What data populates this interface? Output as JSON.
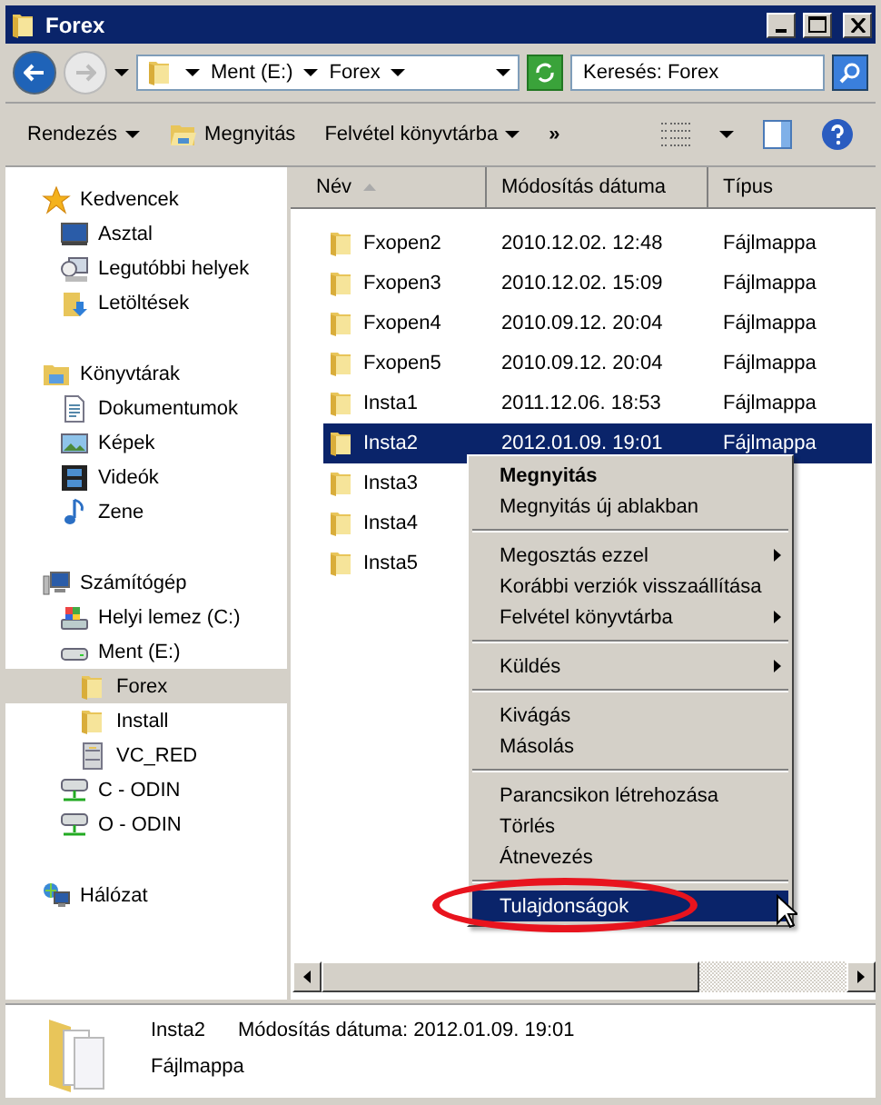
{
  "window": {
    "title": "Forex"
  },
  "address": {
    "crumbs": [
      "Ment (E:)",
      "Forex"
    ],
    "search_placeholder": "Keresés: Forex"
  },
  "toolbar": {
    "items": [
      {
        "label": "Rendezés",
        "kind": "dropdown"
      },
      {
        "label": "Megnyitás",
        "kind": "open"
      },
      {
        "label": "Felvétel könyvtárba",
        "kind": "dropdown"
      },
      {
        "label": "»",
        "kind": "more"
      }
    ]
  },
  "sidebar": {
    "groups": [
      {
        "label": "Kedvencek",
        "kind": "star",
        "children": [
          {
            "label": "Asztal",
            "kind": "desktop",
            "selected": false
          },
          {
            "label": "Legutóbbi helyek",
            "kind": "recent",
            "selected": false
          },
          {
            "label": "Letöltések",
            "kind": "downloads",
            "selected": false
          }
        ]
      },
      {
        "label": "Könyvtárak",
        "kind": "library",
        "children": [
          {
            "label": "Dokumentumok",
            "kind": "document",
            "selected": false
          },
          {
            "label": "Képek",
            "kind": "pictures",
            "selected": false
          },
          {
            "label": "Videók",
            "kind": "video",
            "selected": false
          },
          {
            "label": "Zene",
            "kind": "music",
            "selected": false
          }
        ]
      },
      {
        "label": "Számítógép",
        "kind": "computer",
        "children": [
          {
            "label": "Helyi lemez (C:)",
            "kind": "disk",
            "selected": false
          },
          {
            "label": "Ment (E:)",
            "kind": "drive",
            "selected": false,
            "children": [
              {
                "label": "Forex",
                "kind": "folder",
                "selected": true
              },
              {
                "label": "Install",
                "kind": "folder",
                "selected": false
              },
              {
                "label": "VC_RED",
                "kind": "cabinet",
                "selected": false
              }
            ]
          },
          {
            "label": "C - ODIN",
            "kind": "netdrive",
            "selected": false
          },
          {
            "label": "O - ODIN",
            "kind": "netdrive",
            "selected": false
          }
        ]
      },
      {
        "label": "Hálózat",
        "kind": "network"
      }
    ]
  },
  "table": {
    "columns": [
      {
        "label": "Név",
        "sorted": true
      },
      {
        "label": "Módosítás dátuma",
        "sorted": false
      },
      {
        "label": "Típus",
        "sorted": false
      }
    ],
    "rows": [
      {
        "name": "Fxopen2",
        "date": "2010.12.02. 12:48",
        "type": "Fájlmappa",
        "selected": false
      },
      {
        "name": "Fxopen3",
        "date": "2010.12.02. 15:09",
        "type": "Fájlmappa",
        "selected": false
      },
      {
        "name": "Fxopen4",
        "date": "2010.09.12. 20:04",
        "type": "Fájlmappa",
        "selected": false
      },
      {
        "name": "Fxopen5",
        "date": "2010.09.12. 20:04",
        "type": "Fájlmappa",
        "selected": false
      },
      {
        "name": "Insta1",
        "date": "2011.12.06. 18:53",
        "type": "Fájlmappa",
        "selected": false
      },
      {
        "name": "Insta2",
        "date": "2012.01.09. 19:01",
        "type": "Fájlmappa",
        "selected": true
      },
      {
        "name": "Insta3",
        "selected": false
      },
      {
        "name": "Insta4",
        "selected": false
      },
      {
        "name": "Insta5",
        "selected": false
      }
    ]
  },
  "context_menu": {
    "sections": [
      [
        {
          "label": "Megnyitás",
          "default": true,
          "submenu": false,
          "selected": false
        },
        {
          "label": "Megnyitás új ablakban",
          "default": false,
          "submenu": false,
          "selected": false
        }
      ],
      [
        {
          "label": "Megosztás ezzel",
          "default": false,
          "submenu": true,
          "selected": false
        },
        {
          "label": "Korábbi verziók visszaállítása",
          "default": false,
          "submenu": false,
          "selected": false
        },
        {
          "label": "Felvétel könyvtárba",
          "default": false,
          "submenu": true,
          "selected": false
        }
      ],
      [
        {
          "label": "Küldés",
          "default": false,
          "submenu": true,
          "selected": false
        }
      ],
      [
        {
          "label": "Kivágás",
          "default": false,
          "submenu": false,
          "selected": false
        },
        {
          "label": "Másolás",
          "default": false,
          "submenu": false,
          "selected": false
        }
      ],
      [
        {
          "label": "Parancsikon létrehozása",
          "default": false,
          "submenu": false,
          "selected": false
        },
        {
          "label": "Törlés",
          "default": false,
          "submenu": false,
          "selected": false
        },
        {
          "label": "Átnevezés",
          "default": false,
          "submenu": false,
          "selected": false
        }
      ],
      [
        {
          "label": "Tulajdonságok",
          "default": false,
          "submenu": false,
          "selected": true
        }
      ]
    ]
  },
  "details": {
    "name": "Insta2",
    "modified_label": "Módosítás dátuma:",
    "modified": "2012.01.09. 19:01",
    "type": "Fájlmappa"
  }
}
